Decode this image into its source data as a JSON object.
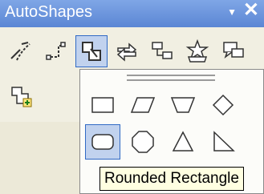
{
  "window": {
    "title": "AutoShapes",
    "menu_glyph": "▼",
    "close_glyph": "✕"
  },
  "toolbar": {
    "buttons": [
      {
        "icon": "lines-icon",
        "name": "Lines"
      },
      {
        "icon": "connectors-icon",
        "name": "Connectors"
      },
      {
        "icon": "basic-shapes-icon",
        "name": "Basic Shapes",
        "active": true
      },
      {
        "icon": "block-arrows-icon",
        "name": "Block Arrows"
      },
      {
        "icon": "flowchart-icon",
        "name": "Flowchart"
      },
      {
        "icon": "stars-banners-icon",
        "name": "Stars and Banners"
      },
      {
        "icon": "callouts-icon",
        "name": "Callouts"
      }
    ],
    "second_row": [
      {
        "icon": "more-autoshapes-icon",
        "name": "More AutoShapes"
      }
    ]
  },
  "palette": {
    "shapes": [
      {
        "name": "Rectangle",
        "icon": "rectangle-icon"
      },
      {
        "name": "Parallelogram",
        "icon": "parallelogram-icon"
      },
      {
        "name": "Trapezoid",
        "icon": "trapezoid-icon"
      },
      {
        "name": "Diamond",
        "icon": "diamond-icon"
      },
      {
        "name": "Rounded Rectangle",
        "icon": "rounded-rectangle-icon",
        "selected": true
      },
      {
        "name": "Octagon",
        "icon": "octagon-icon"
      },
      {
        "name": "Isosceles Triangle",
        "icon": "isosceles-triangle-icon"
      },
      {
        "name": "Right Triangle",
        "icon": "right-triangle-icon"
      }
    ]
  },
  "tooltip": {
    "text": "Rounded Rectangle"
  },
  "colors": {
    "titlebar": "#6b96dd",
    "selection": "#c1d2ee",
    "selection_border": "#316ac5",
    "tooltip_bg": "#ffffe1"
  }
}
